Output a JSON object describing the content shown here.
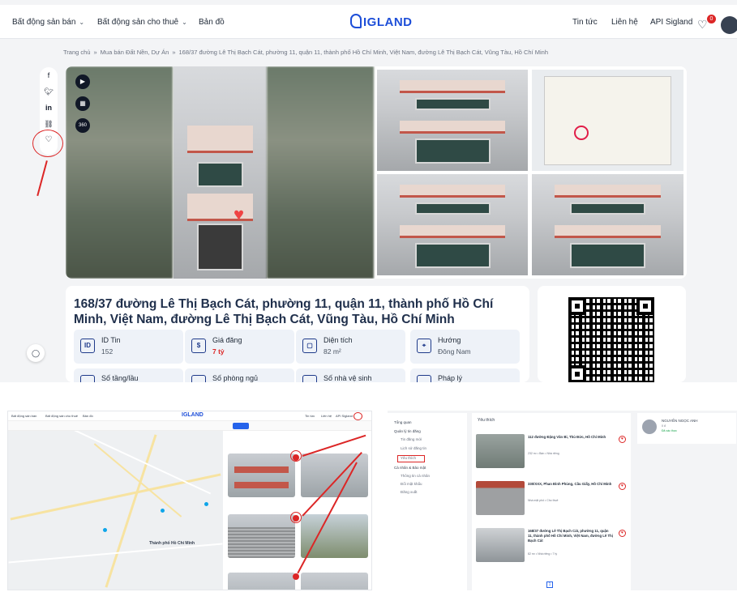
{
  "nav": {
    "items": [
      {
        "label": "Bất động sản bán",
        "has_dropdown": true
      },
      {
        "label": "Bất động sản cho thuê",
        "has_dropdown": true
      },
      {
        "label": "Bản đồ",
        "has_dropdown": false
      }
    ],
    "logo": "IGLAND",
    "right_items": [
      "Tin tức",
      "Liên hệ",
      "API Sigland"
    ],
    "favorites_count": "0"
  },
  "breadcrumb": [
    "Trang chủ",
    "Mua bán Đất Nền, Dự Án",
    "168/37 đường Lê Thị Bạch Cát, phường 11, quận 11, thành phố Hồ Chí Minh, Việt Nam, đường Lê Thị Bạch Cát, Vũng Tàu, Hồ Chí Minh"
  ],
  "share": [
    "f",
    "t",
    "in",
    "link",
    "heart"
  ],
  "gallery_icons": [
    "video",
    "map",
    "360"
  ],
  "property": {
    "title": "168/37 đường Lê Thị Bạch Cát, phường 11, quận 11, thành phố Hồ Chí Minh, Việt Nam, đường Lê Thị Bạch Cát, Vũng Tàu, Hồ Chí Minh",
    "stats": [
      {
        "label": "ID Tin",
        "value": "152",
        "icon": "ID"
      },
      {
        "label": "Giá đăng",
        "value": "7 tỷ",
        "icon": "$",
        "highlight": true
      },
      {
        "label": "Diện tích",
        "value": "82 m²",
        "icon": "▢"
      },
      {
        "label": "Hướng",
        "value": "Đông Nam",
        "icon": "⌖"
      }
    ],
    "stats_row2": [
      "Số tầng/lầu",
      "Số phòng ngủ",
      "Số nhà vệ sinh",
      "Pháp lý"
    ]
  },
  "bottom_left": {
    "mini_nav": [
      "Bất động sản bán",
      "Bất động sản cho thuê",
      "Bản đồ"
    ],
    "mini_logo": "IGLAND",
    "mini_right": [
      "Tin tức",
      "Liên hệ",
      "API Sigland"
    ],
    "city_label": "Thành phố\nHồ Chí Minh"
  },
  "bottom_right": {
    "sidebar": [
      {
        "label": "Tổng quan",
        "sub": false
      },
      {
        "label": "Quản lý tin đăng",
        "sub": false
      },
      {
        "label": "Tin đăng mới",
        "sub": true
      },
      {
        "label": "Lịch sử đăng tin",
        "sub": true
      },
      {
        "label": "Yêu thích",
        "sub": true
      },
      {
        "label": "Cá nhân & Bảo mật",
        "sub": false
      },
      {
        "label": "Thông tin cá nhân",
        "sub": true
      },
      {
        "label": "Đổi mật khẩu",
        "sub": true
      },
      {
        "label": "Đăng xuất",
        "sub": true
      }
    ],
    "section_title": "Yêu thích",
    "favorites": [
      {
        "title": "112 đường Đặng Văn Bi, Thủ Đức, Hồ Chí Minh",
        "tags": "232 m²  •  Bán  •  Nhà riêng"
      },
      {
        "title": "330/XXX, Phan Đình Phùng, Cầu Giấy, Hồ Chí Minh",
        "tags": "Nhà mặt phố  •  Cho thuê"
      },
      {
        "title": "168/37 đường Lê Thị Bạch Cát, phường 11, quận 11, thành phố Hồ Chí Minh, Việt Nam, đường Lê Thị Bạch Cát",
        "tags": "82 m²  •  Nhà riêng  •  7 tỷ"
      }
    ],
    "page": "1",
    "user": {
      "name": "NGUYỄN NGỌC ANH",
      "points": "0 đ",
      "status": "Đã xác thực"
    }
  },
  "colors": {
    "brand": "#1d4ed8",
    "annotation": "#dc2626",
    "price": "#dc2626"
  }
}
